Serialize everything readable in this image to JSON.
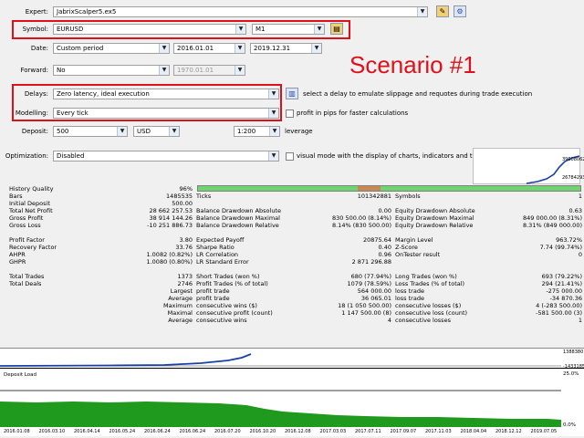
{
  "expert": {
    "label": "Expert:",
    "value": "JabrixScalper5.ex5"
  },
  "symbol": {
    "label": "Symbol:",
    "value": "EURUSD",
    "period": "M1"
  },
  "date": {
    "label": "Date:",
    "value": "Custom period",
    "from": "2016.01.01",
    "to": "2019.12.31"
  },
  "forward": {
    "label": "Forward:",
    "value": "No",
    "date": "1970.01.01"
  },
  "scenario": "Scenario #1",
  "delays": {
    "label": "Delays:",
    "value": "Zero latency, ideal execution",
    "hint": "select a delay to emulate slippage and requotes during trade execution"
  },
  "modelling": {
    "label": "Modelling:",
    "value": "Every tick",
    "hint": "profit in pips for faster calculations"
  },
  "deposit": {
    "label": "Deposit:",
    "value": "500",
    "currency": "USD",
    "leverage": "1:200",
    "leverage_label": "leverage"
  },
  "optimization": {
    "label": "Optimization:",
    "value": "Disabled",
    "hint": "visual mode with the display of charts, indicators and trades"
  },
  "mini_chart": {
    "top": "39608062",
    "bottom": "26784293"
  },
  "results": [
    [
      "History Quality",
      "96%",
      "",
      "",
      "",
      ""
    ],
    [
      "Bars",
      "1485535",
      "Ticks",
      "101342881",
      "Symbols",
      "1"
    ],
    [
      "Initial Deposit",
      "500.00",
      "",
      "",
      "",
      ""
    ],
    [
      "Total Net Profit",
      "28 662 257.53",
      "Balance Drawdown Absolute",
      "0.00",
      "Equity Drawdown Absolute",
      "0.63"
    ],
    [
      "Gross Profit",
      "38 914 144.26",
      "Balance Drawdown Maximal",
      "830 500.00 (8.14%)",
      "Equity Drawdown Maximal",
      "849 000.00 (8.31%)"
    ],
    [
      "Gross Loss",
      "-10 251 886.73",
      "Balance Drawdown Relative",
      "8.14% (830 500.00)",
      "Equity Drawdown Relative",
      "8.31% (849 000.00)"
    ],
    [
      "",
      "",
      "",
      "",
      "",
      ""
    ],
    [
      "Profit Factor",
      "3.80",
      "Expected Payoff",
      "20875.64",
      "Margin Level",
      "963.72%"
    ],
    [
      "Recovery Factor",
      "33.76",
      "Sharpe Ratio",
      "0.40",
      "Z-Score",
      "7.74 (99.74%)"
    ],
    [
      "AHPR",
      "1.0082 (0.82%)",
      "LR Correlation",
      "0.96",
      "OnTester result",
      "0"
    ],
    [
      "GHPR",
      "1.0080 (0.80%)",
      "LR Standard Error",
      "2 871 296.88",
      "",
      ""
    ],
    [
      "",
      "",
      "",
      "",
      "",
      ""
    ],
    [
      "Total Trades",
      "1373",
      "Short Trades (won %)",
      "680 (77.94%)",
      "Long Trades (won %)",
      "693 (79.22%)"
    ],
    [
      "Total Deals",
      "2746",
      "Profit Trades (% of total)",
      "1079 (78.59%)",
      "Loss Trades (% of total)",
      "294 (21.41%)"
    ],
    [
      "",
      "Largest",
      "profit trade",
      "564 000.00",
      "loss trade",
      "-275 000.00"
    ],
    [
      "",
      "Average",
      "profit trade",
      "36 065.01",
      "loss trade",
      "-34 870.36"
    ],
    [
      "",
      "Maximum",
      "consecutive wins ($)",
      "18 (1 050 500.00)",
      "consecutive losses ($)",
      "4 (-283 500.00)"
    ],
    [
      "",
      "Maximal",
      "consecutive profit (count)",
      "1 147 500.00 (8)",
      "consecutive loss (count)",
      "-581 500.00 (3)"
    ],
    [
      "",
      "Average",
      "consecutive wins",
      "4",
      "consecutive losses",
      "1"
    ]
  ],
  "balance_chart": {
    "right_label": "1388380"
  },
  "deposit_load": {
    "label": "Deposit Load",
    "pct_top": "25.0%",
    "pct_bottom": "0.0%",
    "mid_value": "-1433185"
  },
  "x_axis": [
    "2016.01.08",
    "2016.03.10",
    "2016.04.14",
    "2016.05.24",
    "2016.06.24",
    "2016.06.24",
    "2016.07.20",
    "2016.10.20",
    "2016.12.08",
    "2017.03.03",
    "2017.07.11",
    "2017.09.07",
    "2017.11.03",
    "2018.04.04",
    "2018.12.12",
    "2019.07.05"
  ],
  "colors": {
    "accent": "#e0101a",
    "equity": "#1a3fa8",
    "load": "#1f9a1f",
    "hq": "#6fd36f"
  }
}
